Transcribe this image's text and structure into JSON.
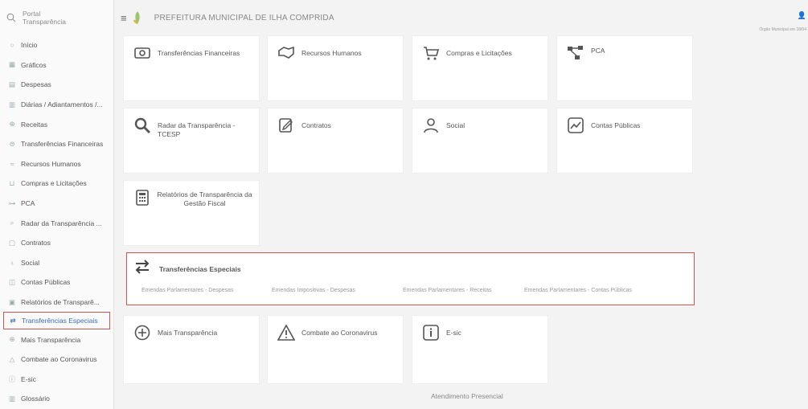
{
  "brand": {
    "line1": "Portal",
    "line2": "Transparência"
  },
  "header": {
    "title": "PREFEITURA MUNICIPAL DE ILHA COMPRIDA",
    "user_text": "Órgão Municipal em 18/04"
  },
  "sidebar": {
    "items": [
      {
        "label": "Início",
        "icon": "home-icon"
      },
      {
        "label": "Gráficos",
        "icon": "chart-icon"
      },
      {
        "label": "Despesas",
        "icon": "expense-icon"
      },
      {
        "label": "Diárias / Adiantamentos /...",
        "icon": "calendar-icon"
      },
      {
        "label": "Receitas",
        "icon": "revenue-icon"
      },
      {
        "label": "Transferências Financeiras",
        "icon": "transfer-icon"
      },
      {
        "label": "Recursos Humanos",
        "icon": "people-icon"
      },
      {
        "label": "Compras e Licitações",
        "icon": "cart-icon"
      },
      {
        "label": "PCA",
        "icon": "network-icon"
      },
      {
        "label": "Radar da Transparência ...",
        "icon": "search-icon"
      },
      {
        "label": "Contratos",
        "icon": "contract-icon"
      },
      {
        "label": "Social",
        "icon": "user-icon"
      },
      {
        "label": "Contas Públicas",
        "icon": "accounts-icon"
      },
      {
        "label": "Relatórios de Transparê...",
        "icon": "calculator-icon"
      },
      {
        "label": "Transferências Especiais",
        "icon": "swap-icon"
      },
      {
        "label": "Mais Transparência",
        "icon": "plus-circle-icon"
      },
      {
        "label": "Combate ao Coronavirus",
        "icon": "warning-icon"
      },
      {
        "label": "E-sic",
        "icon": "info-icon"
      },
      {
        "label": "Glossário",
        "icon": "book-icon"
      }
    ]
  },
  "cards": {
    "transferencias_financeiras": "Transferências Financeiras",
    "recursos_humanos": "Recursos Humanos",
    "compras": "Compras e Licitações",
    "pca": "PCA",
    "radar": "Radar da Transparência - TCESP",
    "contratos": "Contratos",
    "social": "Social",
    "contas_publicas": "Contas Públicas",
    "relatorios_l1": "Relatórios de Transparência da",
    "relatorios_l2": "Gestão Fiscal",
    "mais_transparencia": "Mais Transparência",
    "coronavirus": "Combate ao Coronavirus",
    "esic": "E-sic"
  },
  "special": {
    "title": "Transferências Especiais",
    "links": [
      "Emendas Parlamentares - Despesas",
      "Emendas Impositivas - Despesas",
      "Emendas Parlamentares - Receitas",
      "Emendas Parlamentares - Contas Públicas"
    ]
  },
  "footer": {
    "text": "Atendimento Presencial"
  },
  "colors": {
    "highlight": "#d9534f",
    "active_text": "#3a6fb0",
    "background": "#f3f3f3"
  }
}
